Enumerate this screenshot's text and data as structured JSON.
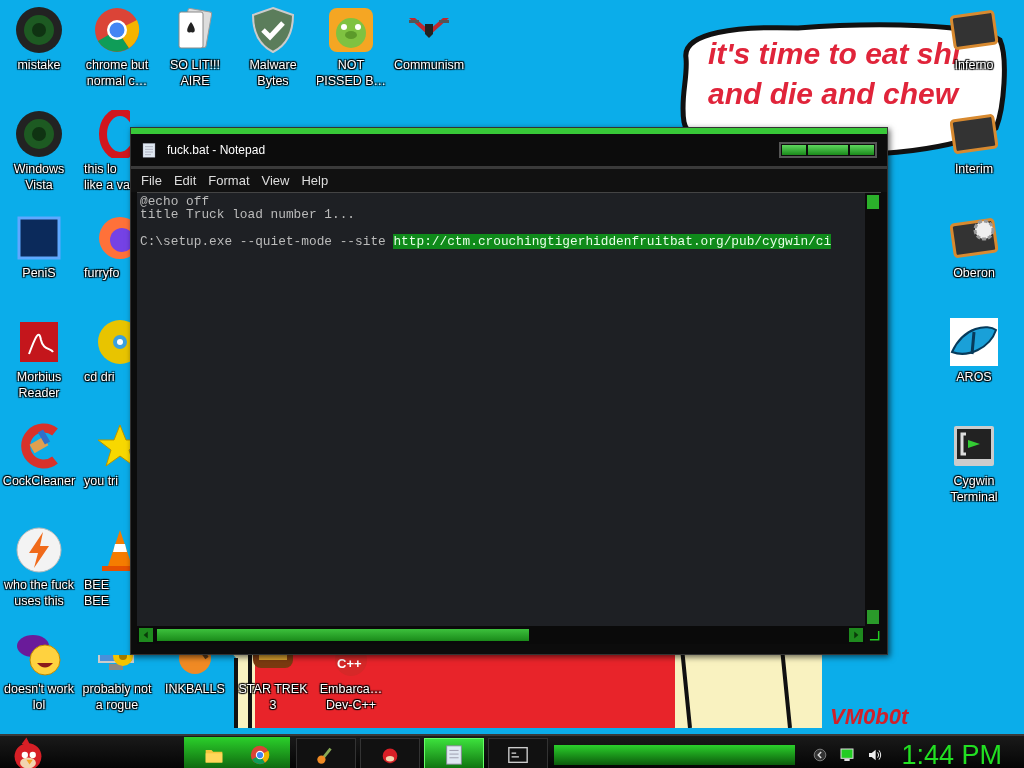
{
  "wallpaper": {
    "bubble_lines": [
      "it's time to eat shi",
      "and die and chew"
    ],
    "signature": "VM0b0t"
  },
  "desktop_rows": [
    [
      {
        "label": "mistake"
      },
      {
        "label": "chrome but\nnormal c…"
      },
      {
        "label": "SO LIT!!!\nAIRE"
      },
      {
        "label": "Malware\nBytes"
      },
      {
        "label": "NOT\nPISSED B…"
      },
      {
        "label": "Communism"
      }
    ],
    [
      {
        "label": "Windows\nVista"
      },
      {
        "label": "this lo\nlike a va"
      }
    ],
    [
      {
        "label": "PeniS"
      },
      {
        "label": "furryfo"
      }
    ],
    [
      {
        "label": "Morbius\nReader"
      },
      {
        "label": "cd dri"
      }
    ],
    [
      {
        "label": "CockCleaner"
      },
      {
        "label": "you tri"
      }
    ],
    [
      {
        "label": "who the fuck\nuses this"
      },
      {
        "label": "BEE\nBEE"
      }
    ],
    [
      {
        "label": "doesn't work\nlol"
      },
      {
        "label": "probably not\na rogue"
      },
      {
        "label": "INKBALLS"
      },
      {
        "label": "STAR TREK\n3"
      },
      {
        "label": "Embarca…\nDev-C++",
        "badge": "C++"
      }
    ]
  ],
  "right_icons": [
    {
      "label": "Inferno"
    },
    {
      "label": "Interim"
    },
    {
      "label": "Oberon"
    },
    {
      "label": "AROS"
    },
    {
      "label": "Cygwin\nTerminal"
    }
  ],
  "window": {
    "title": "fuck.bat - Notepad",
    "menu": [
      "File",
      "Edit",
      "Format",
      "View",
      "Help"
    ],
    "lines": [
      {
        "text": "@echo off"
      },
      {
        "text": "title Truck load number 1..."
      },
      {
        "text": "C:\\setup.exe --quiet-mode --site ",
        "selected_text": "http://ctm.crouchingtigerhiddenfruitbat.org/pub/cygwin/ci"
      }
    ]
  },
  "taskbar": {
    "tasks": [
      {
        "selected": false
      },
      {
        "selected": false
      },
      {
        "selected": true
      },
      {
        "selected": false
      }
    ],
    "clock": "1:44 PM"
  }
}
